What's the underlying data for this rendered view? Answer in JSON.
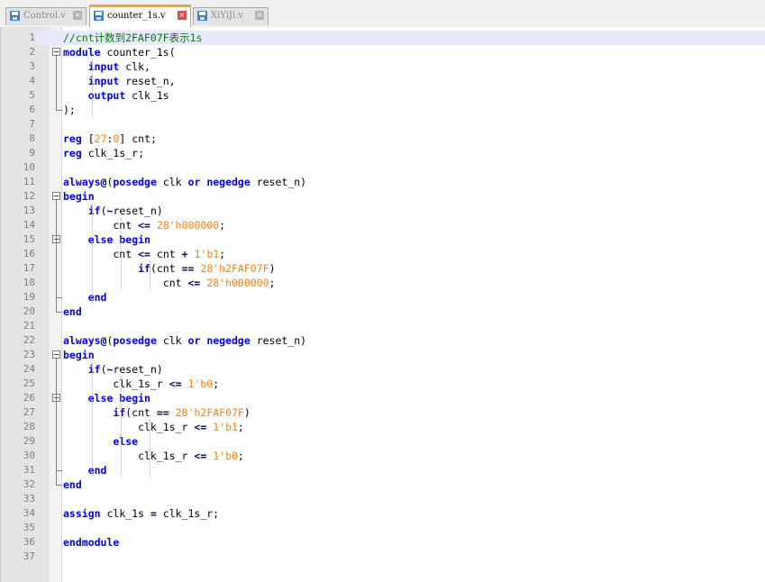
{
  "tabs": [
    {
      "label": "Control.v",
      "active": false
    },
    {
      "label": "counter_1s.v",
      "active": true
    },
    {
      "label": "XiYiJi.v",
      "active": false
    }
  ],
  "editor": {
    "current_line": 1,
    "lines": [
      {
        "n": "1",
        "t": "//cnt计数到2FAF07F表示1s"
      },
      {
        "n": "2",
        "t": "module counter_1s("
      },
      {
        "n": "3",
        "t": "    input clk,"
      },
      {
        "n": "4",
        "t": "    input reset_n,"
      },
      {
        "n": "5",
        "t": "    output clk_1s"
      },
      {
        "n": "6",
        "t": ");"
      },
      {
        "n": "7",
        "t": ""
      },
      {
        "n": "8",
        "t": "reg [27:0] cnt;"
      },
      {
        "n": "9",
        "t": "reg clk_1s_r;"
      },
      {
        "n": "10",
        "t": ""
      },
      {
        "n": "11",
        "t": "always@(posedge clk or negedge reset_n)"
      },
      {
        "n": "12",
        "t": "begin"
      },
      {
        "n": "13",
        "t": "    if(~reset_n)"
      },
      {
        "n": "14",
        "t": "        cnt <= 28'h000000;"
      },
      {
        "n": "15",
        "t": "    else begin"
      },
      {
        "n": "16",
        "t": "        cnt <= cnt + 1'b1;"
      },
      {
        "n": "17",
        "t": "            if(cnt == 28'h2FAF07F)"
      },
      {
        "n": "18",
        "t": "                cnt <= 28'h000000;"
      },
      {
        "n": "19",
        "t": "    end"
      },
      {
        "n": "20",
        "t": "end"
      },
      {
        "n": "21",
        "t": ""
      },
      {
        "n": "22",
        "t": "always@(posedge clk or negedge reset_n)"
      },
      {
        "n": "23",
        "t": "begin"
      },
      {
        "n": "24",
        "t": "    if(~reset_n)"
      },
      {
        "n": "25",
        "t": "        clk_1s_r <= 1'b0;"
      },
      {
        "n": "26",
        "t": "    else begin"
      },
      {
        "n": "27",
        "t": "        if(cnt == 28'h2FAF07F)"
      },
      {
        "n": "28",
        "t": "            clk_1s_r <= 1'b1;"
      },
      {
        "n": "29",
        "t": "        else"
      },
      {
        "n": "30",
        "t": "            clk_1s_r <= 1'b0;"
      },
      {
        "n": "31",
        "t": "    end"
      },
      {
        "n": "32",
        "t": "end"
      },
      {
        "n": "33",
        "t": ""
      },
      {
        "n": "34",
        "t": "assign clk_1s = clk_1s_r;"
      },
      {
        "n": "35",
        "t": ""
      },
      {
        "n": "36",
        "t": "endmodule"
      },
      {
        "n": "37",
        "t": ""
      }
    ]
  }
}
